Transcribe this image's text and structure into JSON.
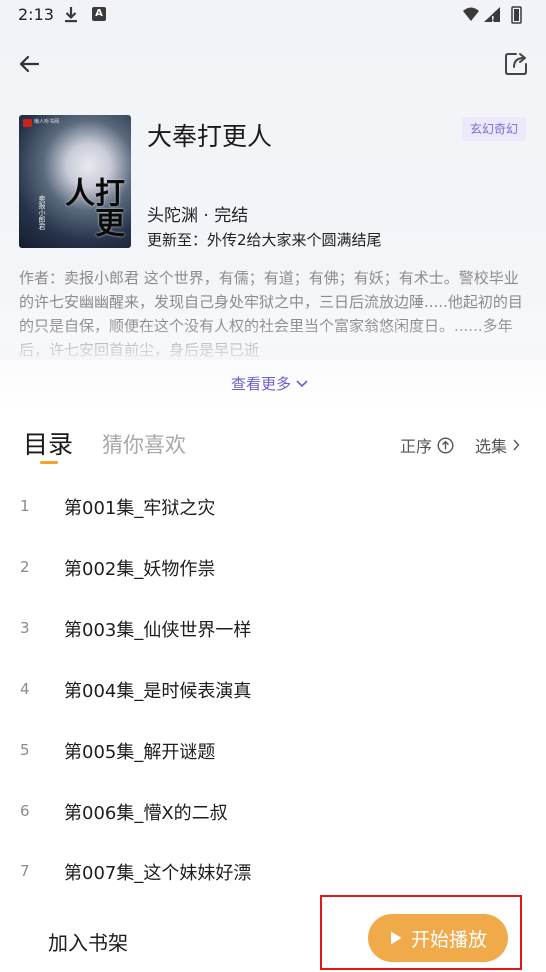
{
  "status_bar": {
    "time": "2:13",
    "icons": [
      "download-icon",
      "app-a-icon",
      "wifi-icon",
      "signal-icon",
      "battery-icon"
    ],
    "app_icon_letter": "A"
  },
  "app_bar": {
    "back_icon": "arrow-left-icon",
    "share_icon": "share-icon"
  },
  "book": {
    "title": "大奉打更人",
    "genre": "玄幻奇幻",
    "author_status": "头陀渊 · 完结",
    "update": "更新至：外传2给大家来个圆满结尾",
    "description": "作者：卖报小郎君 这个世界，有儒；有道；有佛；有妖；有术士。警校毕业的许七安幽幽醒来，发现自己身处牢狱之中，三日后流放边陲.....他起初的目的只是自保，顺便在这个没有人权的社会里当个富家翁悠闲度日。......多年后，许七安回首前尘，身后是早已逝",
    "see_more": "查看更多",
    "cover": {
      "title_text": "打更人",
      "author_text": "卖报小郎君",
      "publisher_text": "懒人听书网"
    }
  },
  "tabs": {
    "catalog": "目录",
    "guess": "猜你喜欢",
    "sort": "正序",
    "select": "选集"
  },
  "episodes": [
    {
      "num": "1",
      "title": "第001集_牢狱之灾"
    },
    {
      "num": "2",
      "title": "第002集_妖物作祟"
    },
    {
      "num": "3",
      "title": "第003集_仙侠世界一样"
    },
    {
      "num": "4",
      "title": "第004集_是时候表演真"
    },
    {
      "num": "5",
      "title": "第005集_解开谜题"
    },
    {
      "num": "6",
      "title": "第006集_懵X的二叔"
    },
    {
      "num": "7",
      "title": "第007集_这个妹妹好漂"
    }
  ],
  "bottom": {
    "add_shelf": "加入书架",
    "play": "开始播放"
  },
  "colors": {
    "accent_orange": "#f0aa4a",
    "link_purple": "#6a5fd0",
    "highlight_red": "#e01818"
  }
}
